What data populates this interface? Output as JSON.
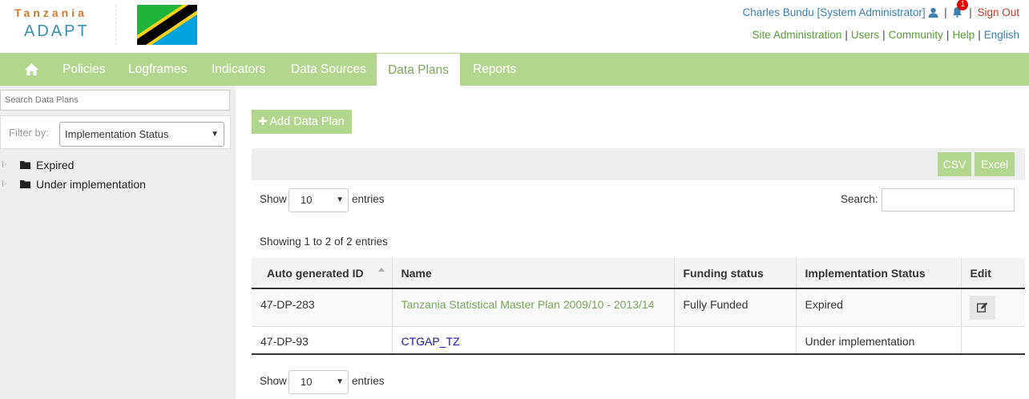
{
  "brand": {
    "title_top": "Tanzania",
    "title_bottom": "ADAPT"
  },
  "user": {
    "display": "Charles Bundu [System Administrator]",
    "notification_count": "1",
    "signout_label": "Sign Out"
  },
  "admin_links": [
    "Site Administration",
    "Users",
    "Community",
    "Help",
    "English"
  ],
  "nav": {
    "items": [
      "Policies",
      "Logframes",
      "Indicators",
      "Data Sources",
      "Data Plans",
      "Reports"
    ],
    "active": "Data Plans"
  },
  "sidebar": {
    "search_placeholder": "Search Data Plans",
    "filter_label": "Filter by:",
    "filter_value": "Implementation Status",
    "tree": [
      "Expired",
      "Under implementation"
    ]
  },
  "main": {
    "add_button": "Add Data Plan",
    "export_buttons": [
      "CSV",
      "Excel"
    ],
    "show_label": "Show",
    "page_size": "10",
    "entries_label": "entries",
    "search_label": "Search:",
    "showing_text": "Showing 1 to 2 of 2 entries"
  },
  "table": {
    "columns": [
      "Auto generated ID",
      "Name",
      "Funding status",
      "Implementation Status",
      "Edit"
    ],
    "rows": [
      {
        "id": "47-DP-283",
        "name": "Tanzania Statistical Master Plan 2009/10 - 2013/14",
        "funding": "Fully Funded",
        "status": "Expired"
      },
      {
        "id": "47-DP-93",
        "name": "CTGAP_TZ",
        "funding": "",
        "status": "Under implementation"
      }
    ]
  },
  "colors": {
    "nav_green": "#b3d68f",
    "link_green": "#7aa65a",
    "link_blue": "#3a7fb0",
    "signout_red": "#c0392b"
  }
}
